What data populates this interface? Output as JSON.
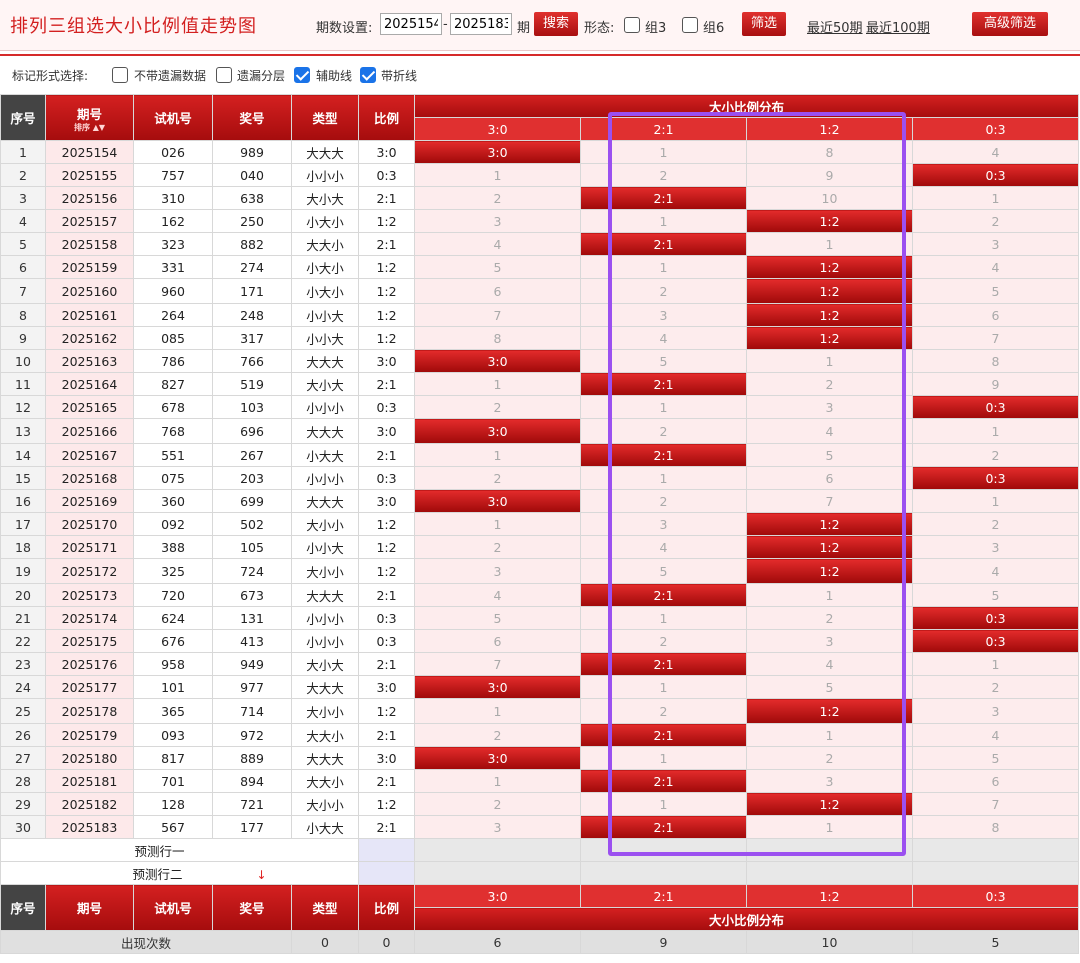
{
  "header": {
    "title": "排列三组选大小比例值走势图",
    "period_label": "期数设置:",
    "period_from": "2025154",
    "period_dash": "-",
    "period_to": "2025183",
    "period_unit": "期",
    "search_btn": "搜索",
    "form_label": "形态:",
    "group3_label": "组3",
    "group6_label": "组6",
    "filter_btn": "筛选",
    "recent50": "最近50期",
    "recent100": "最近100期",
    "advanced_btn": "高级筛选"
  },
  "options": {
    "label": "标记形式选择:",
    "items": [
      {
        "label": "不带遗漏数据",
        "checked": false
      },
      {
        "label": "遗漏分层",
        "checked": false
      },
      {
        "label": "辅助线",
        "checked": true
      },
      {
        "label": "带折线",
        "checked": true
      }
    ]
  },
  "table": {
    "headers": {
      "seq": "序号",
      "issue": "期号",
      "sort": "排序",
      "trial": "试机号",
      "prize": "奖号",
      "type": "类型",
      "ratio": "比例",
      "dist": "大小比例分布",
      "dist_cols": [
        "3:0",
        "2:1",
        "1:2",
        "0:3"
      ]
    },
    "rows": [
      {
        "seq": "1",
        "issue": "2025154",
        "trial": "026",
        "prize": "989",
        "type": "大大大",
        "ratio": "3:0",
        "dist": [
          "3:0",
          "1",
          "8",
          "4"
        ],
        "hit": 0
      },
      {
        "seq": "2",
        "issue": "2025155",
        "trial": "757",
        "prize": "040",
        "type": "小小小",
        "ratio": "0:3",
        "dist": [
          "1",
          "2",
          "9",
          "0:3"
        ],
        "hit": 3
      },
      {
        "seq": "3",
        "issue": "2025156",
        "trial": "310",
        "prize": "638",
        "type": "大小大",
        "ratio": "2:1",
        "dist": [
          "2",
          "2:1",
          "10",
          "1"
        ],
        "hit": 1
      },
      {
        "seq": "4",
        "issue": "2025157",
        "trial": "162",
        "prize": "250",
        "type": "小大小",
        "ratio": "1:2",
        "dist": [
          "3",
          "1",
          "1:2",
          "2"
        ],
        "hit": 2
      },
      {
        "seq": "5",
        "issue": "2025158",
        "trial": "323",
        "prize": "882",
        "type": "大大小",
        "ratio": "2:1",
        "dist": [
          "4",
          "2:1",
          "1",
          "3"
        ],
        "hit": 1
      },
      {
        "seq": "6",
        "issue": "2025159",
        "trial": "331",
        "prize": "274",
        "type": "小大小",
        "ratio": "1:2",
        "dist": [
          "5",
          "1",
          "1:2",
          "4"
        ],
        "hit": 2
      },
      {
        "seq": "7",
        "issue": "2025160",
        "trial": "960",
        "prize": "171",
        "type": "小大小",
        "ratio": "1:2",
        "dist": [
          "6",
          "2",
          "1:2",
          "5"
        ],
        "hit": 2
      },
      {
        "seq": "8",
        "issue": "2025161",
        "trial": "264",
        "prize": "248",
        "type": "小小大",
        "ratio": "1:2",
        "dist": [
          "7",
          "3",
          "1:2",
          "6"
        ],
        "hit": 2
      },
      {
        "seq": "9",
        "issue": "2025162",
        "trial": "085",
        "prize": "317",
        "type": "小小大",
        "ratio": "1:2",
        "dist": [
          "8",
          "4",
          "1:2",
          "7"
        ],
        "hit": 2
      },
      {
        "seq": "10",
        "issue": "2025163",
        "trial": "786",
        "prize": "766",
        "type": "大大大",
        "ratio": "3:0",
        "dist": [
          "3:0",
          "5",
          "1",
          "8"
        ],
        "hit": 0
      },
      {
        "seq": "11",
        "issue": "2025164",
        "trial": "827",
        "prize": "519",
        "type": "大小大",
        "ratio": "2:1",
        "dist": [
          "1",
          "2:1",
          "2",
          "9"
        ],
        "hit": 1
      },
      {
        "seq": "12",
        "issue": "2025165",
        "trial": "678",
        "prize": "103",
        "type": "小小小",
        "ratio": "0:3",
        "dist": [
          "2",
          "1",
          "3",
          "0:3"
        ],
        "hit": 3
      },
      {
        "seq": "13",
        "issue": "2025166",
        "trial": "768",
        "prize": "696",
        "type": "大大大",
        "ratio": "3:0",
        "dist": [
          "3:0",
          "2",
          "4",
          "1"
        ],
        "hit": 0
      },
      {
        "seq": "14",
        "issue": "2025167",
        "trial": "551",
        "prize": "267",
        "type": "小大大",
        "ratio": "2:1",
        "dist": [
          "1",
          "2:1",
          "5",
          "2"
        ],
        "hit": 1
      },
      {
        "seq": "15",
        "issue": "2025168",
        "trial": "075",
        "prize": "203",
        "type": "小小小",
        "ratio": "0:3",
        "dist": [
          "2",
          "1",
          "6",
          "0:3"
        ],
        "hit": 3
      },
      {
        "seq": "16",
        "issue": "2025169",
        "trial": "360",
        "prize": "699",
        "type": "大大大",
        "ratio": "3:0",
        "dist": [
          "3:0",
          "2",
          "7",
          "1"
        ],
        "hit": 0
      },
      {
        "seq": "17",
        "issue": "2025170",
        "trial": "092",
        "prize": "502",
        "type": "大小小",
        "ratio": "1:2",
        "dist": [
          "1",
          "3",
          "1:2",
          "2"
        ],
        "hit": 2
      },
      {
        "seq": "18",
        "issue": "2025171",
        "trial": "388",
        "prize": "105",
        "type": "小小大",
        "ratio": "1:2",
        "dist": [
          "2",
          "4",
          "1:2",
          "3"
        ],
        "hit": 2
      },
      {
        "seq": "19",
        "issue": "2025172",
        "trial": "325",
        "prize": "724",
        "type": "大小小",
        "ratio": "1:2",
        "dist": [
          "3",
          "5",
          "1:2",
          "4"
        ],
        "hit": 2
      },
      {
        "seq": "20",
        "issue": "2025173",
        "trial": "720",
        "prize": "673",
        "type": "大大大",
        "ratio": "2:1",
        "dist": [
          "4",
          "2:1",
          "1",
          "5"
        ],
        "hit": 1
      },
      {
        "seq": "21",
        "issue": "2025174",
        "trial": "624",
        "prize": "131",
        "type": "小小小",
        "ratio": "0:3",
        "dist": [
          "5",
          "1",
          "2",
          "0:3"
        ],
        "hit": 3
      },
      {
        "seq": "22",
        "issue": "2025175",
        "trial": "676",
        "prize": "413",
        "type": "小小小",
        "ratio": "0:3",
        "dist": [
          "6",
          "2",
          "3",
          "0:3"
        ],
        "hit": 3
      },
      {
        "seq": "23",
        "issue": "2025176",
        "trial": "958",
        "prize": "949",
        "type": "大小大",
        "ratio": "2:1",
        "dist": [
          "7",
          "2:1",
          "4",
          "1"
        ],
        "hit": 1
      },
      {
        "seq": "24",
        "issue": "2025177",
        "trial": "101",
        "prize": "977",
        "type": "大大大",
        "ratio": "3:0",
        "dist": [
          "3:0",
          "1",
          "5",
          "2"
        ],
        "hit": 0
      },
      {
        "seq": "25",
        "issue": "2025178",
        "trial": "365",
        "prize": "714",
        "type": "大小小",
        "ratio": "1:2",
        "dist": [
          "1",
          "2",
          "1:2",
          "3"
        ],
        "hit": 2
      },
      {
        "seq": "26",
        "issue": "2025179",
        "trial": "093",
        "prize": "972",
        "type": "大大小",
        "ratio": "2:1",
        "dist": [
          "2",
          "2:1",
          "1",
          "4"
        ],
        "hit": 1
      },
      {
        "seq": "27",
        "issue": "2025180",
        "trial": "817",
        "prize": "889",
        "type": "大大大",
        "ratio": "3:0",
        "dist": [
          "3:0",
          "1",
          "2",
          "5"
        ],
        "hit": 0
      },
      {
        "seq": "28",
        "issue": "2025181",
        "trial": "701",
        "prize": "894",
        "type": "大大小",
        "ratio": "2:1",
        "dist": [
          "1",
          "2:1",
          "3",
          "6"
        ],
        "hit": 1
      },
      {
        "seq": "29",
        "issue": "2025182",
        "trial": "128",
        "prize": "721",
        "type": "大小小",
        "ratio": "1:2",
        "dist": [
          "2",
          "1",
          "1:2",
          "7"
        ],
        "hit": 2
      },
      {
        "seq": "30",
        "issue": "2025183",
        "trial": "567",
        "prize": "177",
        "type": "小大大",
        "ratio": "2:1",
        "dist": [
          "3",
          "2:1",
          "1",
          "8"
        ],
        "hit": 1
      }
    ],
    "predict1": "预测行一",
    "predict2": "预测行二",
    "predict2_arrow": "↓",
    "footer": {
      "label": "出现次数",
      "type_count": "0",
      "ratio_count": "0",
      "dist_counts": [
        "6",
        "9",
        "10",
        "5"
      ]
    }
  },
  "colors": {
    "accent": "#d32020",
    "highlight": "#9b50f0",
    "checkbox": "#1a73e8"
  }
}
